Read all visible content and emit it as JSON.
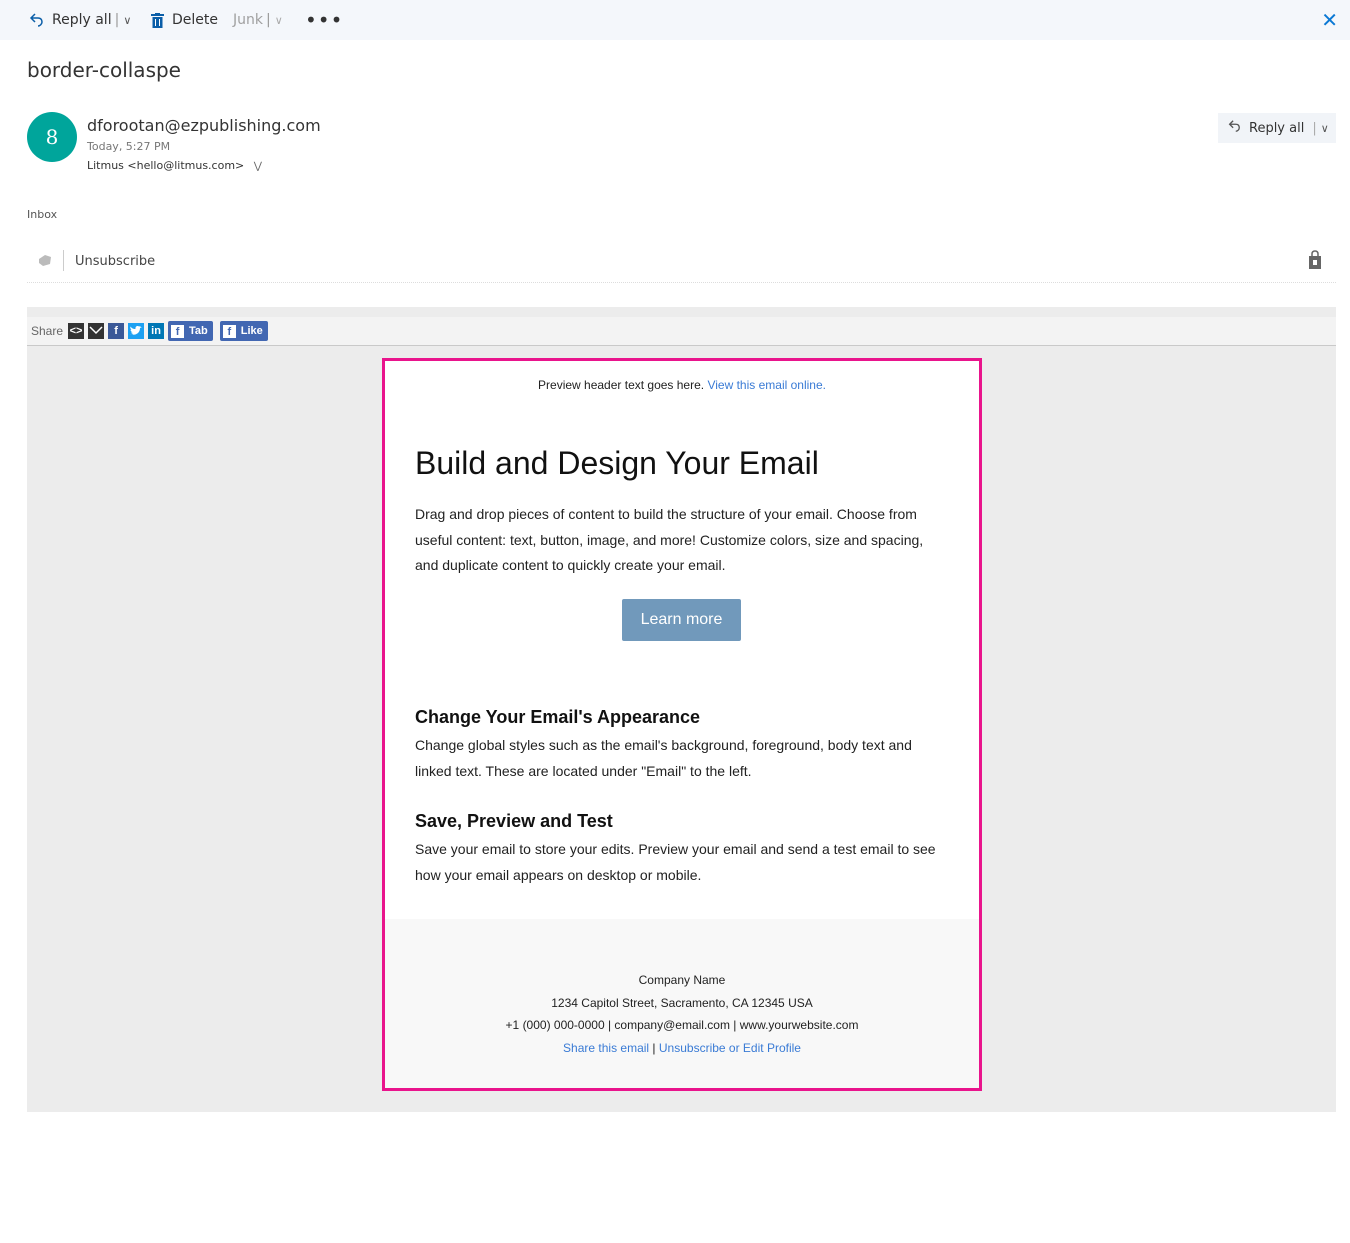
{
  "toolbar": {
    "reply_all": "Reply all",
    "delete": "Delete",
    "junk": "Junk",
    "more": "•••"
  },
  "message": {
    "subject": "border-collaspe",
    "avatar_initial": "8",
    "sender": "dforootan@ezpublishing.com",
    "time": "Today, 5:27 PM",
    "to": "Litmus <hello@litmus.com>",
    "reply_all": "Reply all",
    "folder": "Inbox",
    "unsubscribe": "Unsubscribe"
  },
  "share": {
    "label": "Share",
    "tab": "Tab",
    "like": "Like"
  },
  "email": {
    "preheader_text": "Preview header text goes here.",
    "preheader_link": "View this email online.",
    "heading": "Build and Design Your Email",
    "intro_line1": "Drag and drop pieces of content to build the structure of your email. Choose from",
    "intro_line2": "useful content: text, button, image, and more! Customize colors, size and spacing,",
    "intro_line3": "and duplicate content to quickly create your email.",
    "button": "Learn more",
    "section1_title": "Change Your Email's Appearance",
    "section1_line1": "Change global styles such as the email's background, foreground, body text and",
    "section1_line2": "linked text. These are located under \"Email\" to the left.",
    "section2_title": "Save, Preview and Test",
    "section2_line1": "Save your email to store your edits. Preview your email and send a test email to see",
    "section2_line2": "how your email appears on desktop or mobile.",
    "footer_company": "Company Name",
    "footer_address": "1234 Capitol Street, Sacramento, CA 12345 USA",
    "footer_contact": "+1 (000) 000-0000 | company@email.com | www.yourwebsite.com",
    "footer_share": "Share this email",
    "footer_pipe": " | ",
    "footer_unsub": "Unsubscribe or Edit Profile"
  },
  "colors": {
    "accent": "#0a78d4",
    "avatar": "#00a59b",
    "email_border": "#e9148c",
    "button": "#7199bb",
    "link": "#3a7bd5"
  }
}
